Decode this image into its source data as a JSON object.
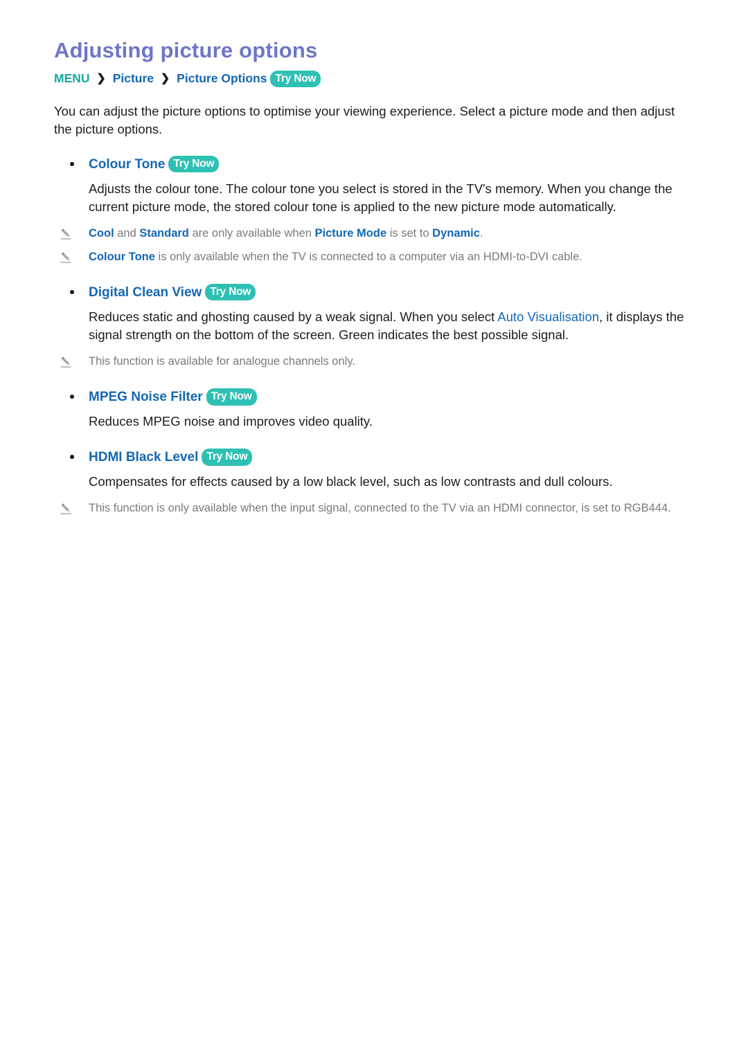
{
  "document": {
    "title": "Adjusting picture options",
    "breadcrumb": {
      "menu": "MENU",
      "separator": "❯",
      "item1": "Picture",
      "item2": "Picture Options",
      "try_now": "Try Now"
    },
    "intro": "You can adjust the picture options to optimise your viewing experience. Select a picture mode and then adjust the picture options."
  },
  "colors": {
    "title": "#6f76c6",
    "accent_teal": "#2ec0b4",
    "menu_teal": "#13a89e",
    "link_blue": "#1467b3",
    "body_text": "#1d1d1d",
    "note_text": "#7a7a7a",
    "bullet": "#161616"
  },
  "sections": [
    {
      "heading": "Colour Tone",
      "try_now": "Try Now",
      "body": "Adjusts the colour tone. The colour tone you select is stored in the TV's memory. When you change the current picture mode, the stored colour tone is applied to the new picture mode automatically.",
      "notes": [
        {
          "icon": "pencil-icon",
          "parts": [
            {
              "text": "Cool",
              "style": "bold-blue"
            },
            {
              "text": " and ",
              "style": "plain"
            },
            {
              "text": "Standard",
              "style": "bold-blue"
            },
            {
              "text": " are only available when ",
              "style": "plain"
            },
            {
              "text": "Picture Mode",
              "style": "bold-blue"
            },
            {
              "text": " is set to ",
              "style": "plain"
            },
            {
              "text": "Dynamic",
              "style": "bold-blue"
            },
            {
              "text": ".",
              "style": "plain"
            }
          ]
        },
        {
          "icon": "pencil-icon",
          "parts": [
            {
              "text": "Colour Tone",
              "style": "bold-blue"
            },
            {
              "text": " is only available when the TV is connected to a computer via an HDMI-to-DVI cable.",
              "style": "plain"
            }
          ]
        }
      ]
    },
    {
      "heading": "Digital Clean View",
      "try_now": "Try Now",
      "body_pre": "Reduces static and ghosting caused by a weak signal. When you select ",
      "body_link": "Auto Visualisation",
      "body_post": ", it displays the signal strength on the bottom of the screen. Green indicates the best possible signal.",
      "notes": [
        {
          "icon": "pencil-icon",
          "parts": [
            {
              "text": "This function is available for analogue channels only.",
              "style": "plain"
            }
          ]
        }
      ]
    },
    {
      "heading": "MPEG Noise Filter",
      "try_now": "Try Now",
      "body": "Reduces MPEG noise and improves video quality.",
      "notes": []
    },
    {
      "heading": "HDMI Black Level",
      "try_now": "Try Now",
      "body": "Compensates for effects caused by a low black level, such as low contrasts and dull colours.",
      "notes": [
        {
          "icon": "pencil-icon",
          "parts": [
            {
              "text": "This function is only available when the input signal, connected to the TV via an HDMI connector, is set to RGB444.",
              "style": "plain"
            }
          ]
        }
      ]
    }
  ]
}
